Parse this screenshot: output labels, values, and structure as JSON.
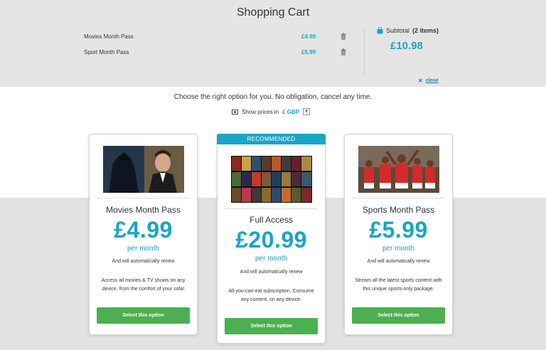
{
  "cart": {
    "title": "Shopping Cart",
    "items": [
      {
        "name": "Movies Month Pass",
        "price": "£4.99"
      },
      {
        "name": "Sport Month Pass",
        "price": "£5.99"
      }
    ],
    "subtotal_label": "Subtotal",
    "subtotal_count": "(2 items)",
    "subtotal_amount": "£10.98",
    "close_label": "close"
  },
  "offer": {
    "tagline": "Choose the right option for you. No obligation, cancel any time.",
    "prices_in_label": "Show prices in",
    "currency": "£ GBP"
  },
  "plans": [
    {
      "name": "Movies Month Pass",
      "price": "£4.99",
      "period": "per month",
      "renew": "And will automatically renew",
      "description": "Access all movies & TV shows on any device, from the comfort of your sofa!",
      "button": "Select this option"
    },
    {
      "badge": "RECOMMENDED",
      "name": "Full Access",
      "price": "£20.99",
      "period": "per month",
      "renew": "And will automatically renew",
      "description": "All-you-can-eat subscription. Consume any content, on any device.",
      "button": "Select this option"
    },
    {
      "name": "Sports Month Pass",
      "price": "£5.99",
      "period": "per month",
      "renew": "And will automatically renew",
      "description": "Stream all the latest sports content with this unique sports-only package.",
      "button": "Select this option"
    }
  ],
  "colors": {
    "accent": "#1aa5c4",
    "button": "#4caf50",
    "panel_bg": "#e5e5e5"
  },
  "icons": {
    "trash": "trash-icon",
    "bag": "shopping-bag-icon",
    "close": "close-icon",
    "money": "money-icon",
    "dropdown": "chevron-down-icon"
  }
}
